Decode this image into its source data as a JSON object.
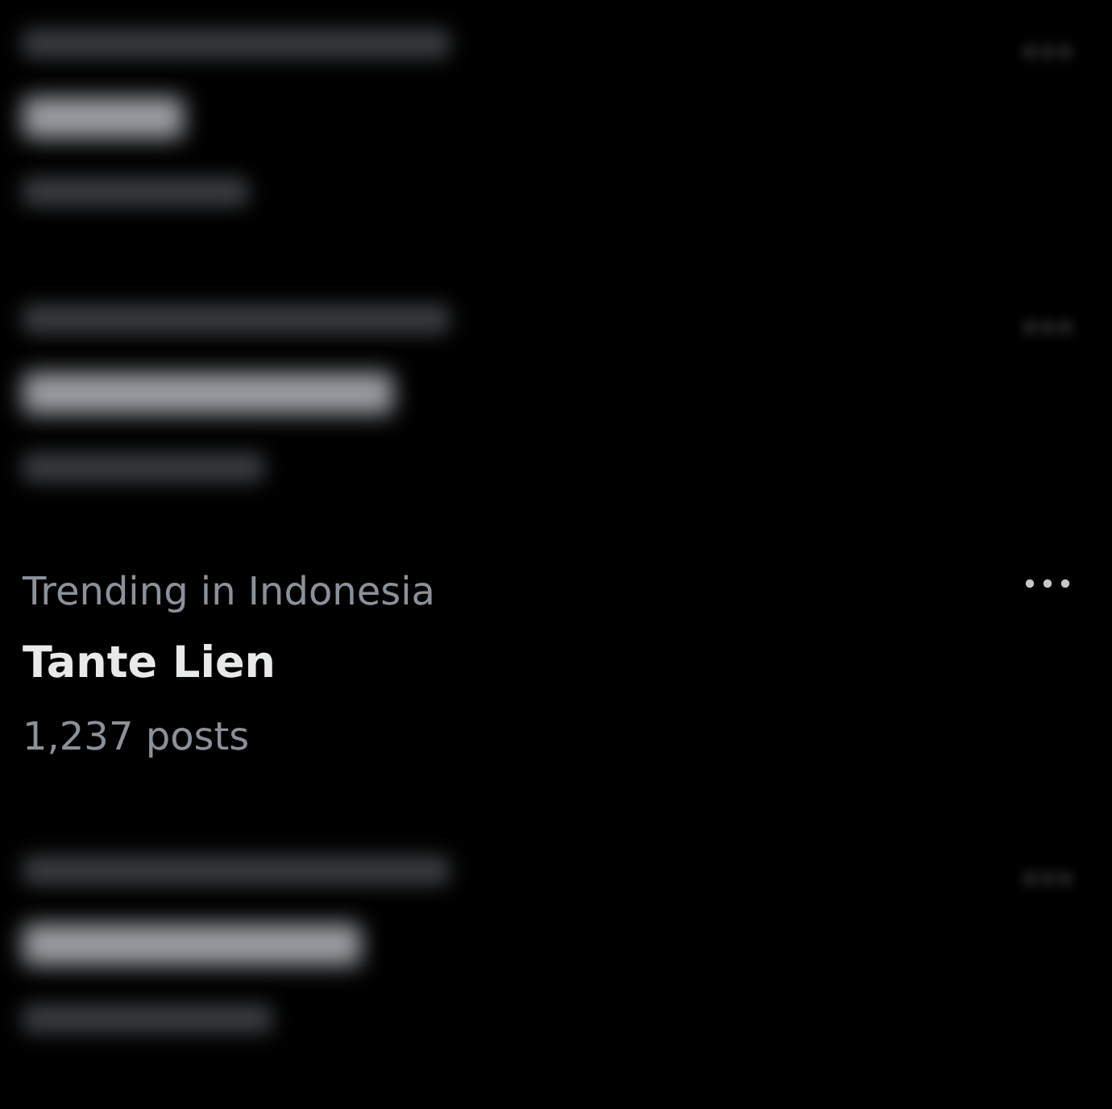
{
  "trends": [
    {
      "kind": "blurred"
    },
    {
      "kind": "blurred"
    },
    {
      "kind": "trend",
      "category": "Trending in Indonesia",
      "title": "Tante Lien",
      "posts": "1,237 posts"
    },
    {
      "kind": "blurred"
    }
  ]
}
